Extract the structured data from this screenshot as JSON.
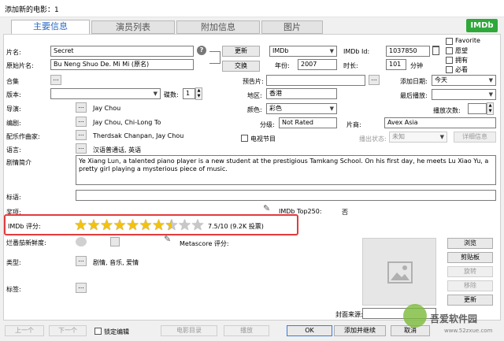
{
  "window": {
    "title": "添加新的电影：1"
  },
  "tabs": [
    {
      "label": "主要信息"
    },
    {
      "label": "演员列表"
    },
    {
      "label": "附加信息"
    },
    {
      "label": "图片"
    }
  ],
  "imdb_badge": "IMDb",
  "fields": {
    "title_label": "片名:",
    "title_value": "Secret",
    "orig_title_label": "原始片名:",
    "orig_title_value": "Bu Neng Shuo De. Mi Mi (原名)",
    "collection_label": "合集",
    "version_label": "版本:",
    "discs_label": "碟数:",
    "discs_value": "1",
    "director_label": "导演:",
    "director_value": "Jay Chou",
    "writer_label": "编剧:",
    "writer_value": "Jay Chou, Chi-Long To",
    "composer_label": "配乐作曲家:",
    "composer_value": "Therdsak Chanpan, Jay Chou",
    "language_label": "语言:",
    "language_value": "汉语普通话, 英语",
    "plot_label": "剧情简介",
    "plot_value": "Ye Xiang Lun, a talented piano player is a new student at the prestigious Tamkang School. On his first day, he meets Lu Xiao Yu, a pretty girl playing a mysterious piece of music.",
    "tagline_label": "标语:",
    "awards_label": "奖项:",
    "imdb_rating_label": "IMDb 评分:",
    "imdb_rating_text": "7.5/10 (9.2K 投票)",
    "rt_label": "烂番茄新鲜度:",
    "metascore_label": "Metascore 评分:",
    "genre_label": "类型:",
    "genre_value": "剧情, 音乐, 爱情",
    "tags_label": "标签:",
    "imdb_top250_label": "IMDb Top250:",
    "imdb_top250_value": "否"
  },
  "right": {
    "update_button": "更新",
    "swap_button": "交换",
    "source_value": "IMDb",
    "imdb_id_label": "IMDb Id:",
    "imdb_id_value": "1037850",
    "year_label": "年份:",
    "year_value": "2007",
    "runtime_label": "时长:",
    "runtime_value": "101",
    "runtime_unit": "分钟",
    "favorite": "Favorite",
    "wish": "愿望",
    "owned": "拥有",
    "must_see": "必看",
    "trailer_label": "预告片:",
    "added_label": "添加日期:",
    "added_value": "今天",
    "region_label": "地区:",
    "region_value": "香港",
    "last_played_label": "最后播放:",
    "color_label": "颜色:",
    "color_value": "彩色",
    "play_count_label": "播放次数:",
    "rating_label": "分级:",
    "rating_value": "Not Rated",
    "studio_label": "片商:",
    "studio_value": "Avex Asia",
    "tv_label": "电视节目",
    "release_label": "播出状态:",
    "release_value": "未知",
    "details_button": "详细信息"
  },
  "cover": {
    "browse": "浏览",
    "clipboard": "剪贴板",
    "rotate": "旋转",
    "remove": "移除",
    "refresh": "更新",
    "source_label": "封面来源:"
  },
  "bottom": {
    "prev": "上一个",
    "next": "下一个",
    "lock": "锁定编辑",
    "movie_dir": "电影目录",
    "play": "播放",
    "ok": "OK",
    "add_continue": "添加并继续",
    "cancel": "取消"
  },
  "rating": {
    "value": 7.5,
    "max": 10
  },
  "watermark": "吾爱软件园",
  "watermark_url": "www.52zxue.com",
  "colors": {
    "accent": "#2a6ac8",
    "highlight": "#e23b3b",
    "star": "#f4c20d"
  }
}
